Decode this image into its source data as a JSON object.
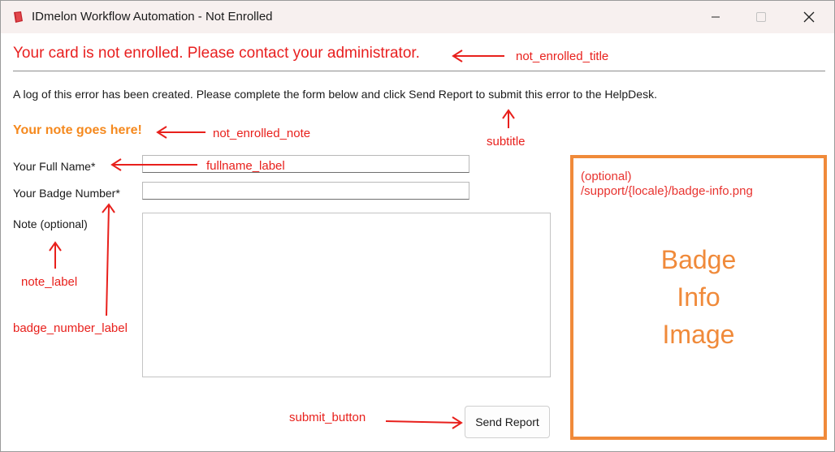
{
  "window": {
    "title": "IDmelon Workflow Automation - Not Enrolled"
  },
  "header": {
    "title": "Your card is not enrolled. Please contact your administrator.",
    "subtitle": "A log of this error has been created. Please complete the form below and click Send Report to submit this error to the HelpDesk."
  },
  "note": "Your note goes here!",
  "form": {
    "fullname_label": "Your Full Name*",
    "badge_number_label": "Your Badge Number*",
    "note_label": "Note (optional)",
    "submit_label": "Send Report"
  },
  "badge_image": {
    "path_line1": "(optional)",
    "path_line2": "/support/{locale}/badge-info.png",
    "word1": "Badge",
    "word2": "Info",
    "word3": "Image"
  },
  "annotations": {
    "title": "not_enrolled_title",
    "note": "not_enrolled_note",
    "subtitle": "subtitle",
    "fullname": "fullname_label",
    "note_label": "note_label",
    "badge_number": "badge_number_label",
    "submit": "submit_button"
  },
  "colors": {
    "title_red": "#e81f1f",
    "note_orange": "#f5891e",
    "badge_border": "#f08a3a",
    "annotation_red": "#e8201c"
  },
  "icons": {
    "app": "idmelon-app-icon",
    "minimize": "minimize-icon",
    "maximize": "maximize-icon",
    "close": "close-icon"
  }
}
